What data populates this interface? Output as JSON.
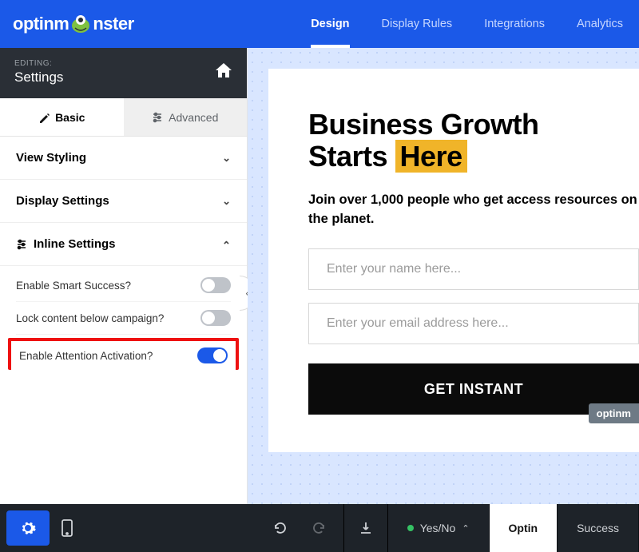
{
  "brand": "optinmonster",
  "topnav": {
    "items": [
      "Design",
      "Display Rules",
      "Integrations",
      "Analytics"
    ],
    "active": "Design"
  },
  "sidebar": {
    "editing_label": "EDITING:",
    "title": "Settings",
    "subtabs": {
      "basic": "Basic",
      "advanced": "Advanced"
    },
    "sections": {
      "view_styling": "View Styling",
      "display_settings": "Display Settings",
      "inline_settings": "Inline Settings"
    },
    "inline_rows": {
      "smart_success": {
        "label": "Enable Smart Success?",
        "on": false
      },
      "lock_content": {
        "label": "Lock content below campaign?",
        "on": false
      },
      "attention": {
        "label": "Enable Attention Activation?",
        "on": true
      }
    }
  },
  "preview": {
    "headline_a": "Business Growth",
    "headline_b_prefix": "Starts ",
    "headline_b_highlight": "Here",
    "subhead": "Join over 1,000 people who get access resources on the planet.",
    "name_placeholder": "Enter your name here...",
    "email_placeholder": "Enter your email address here...",
    "cta": "GET INSTANT",
    "badge": "optinm"
  },
  "bottom": {
    "views": {
      "yesno": "Yes/No",
      "optin": "Optin",
      "success": "Success"
    }
  }
}
